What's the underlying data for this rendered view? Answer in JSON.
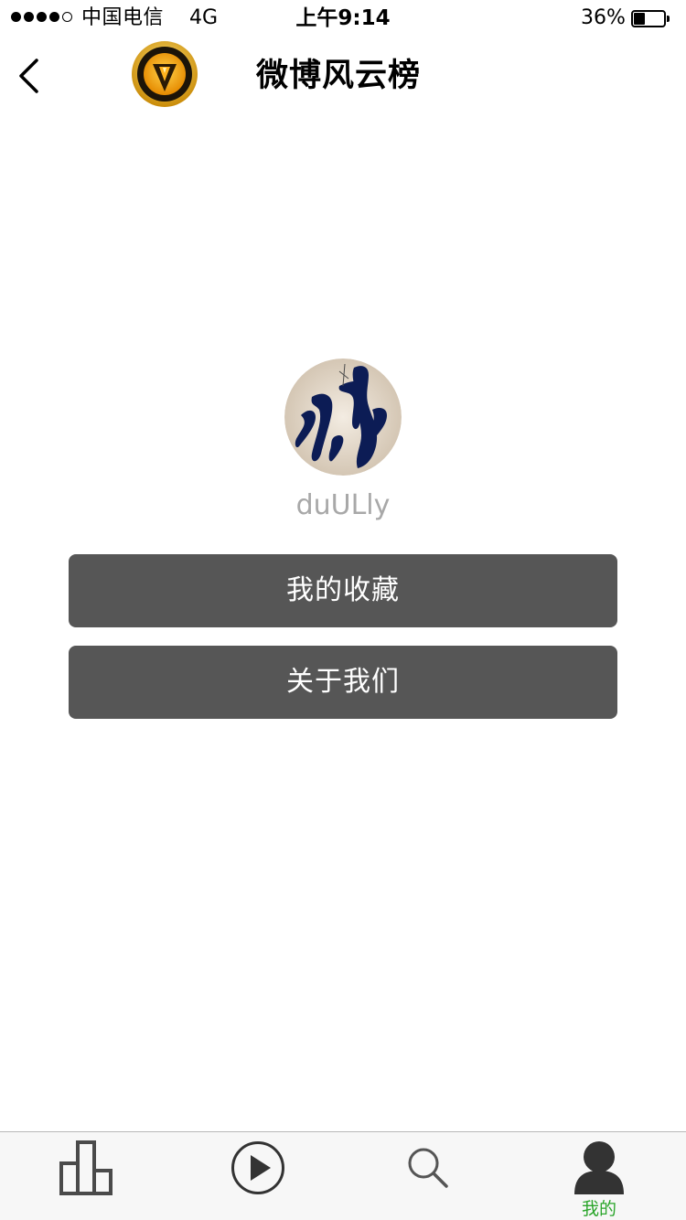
{
  "status_bar": {
    "signal_bars": 5,
    "signal_filled": 4,
    "carrier": "中国电信",
    "network": "4G",
    "time": "上午9:14",
    "battery_percent_text": "36%",
    "battery_level": 0.36
  },
  "nav": {
    "back_icon": "chevron-left-icon",
    "logo_icon": "gold-badge-logo",
    "title": "微博风云榜"
  },
  "profile": {
    "username": "duULly"
  },
  "menu": {
    "favorites_label": "我的收藏",
    "about_label": "关于我们"
  },
  "tab_bar": {
    "tabs": [
      {
        "icon": "bar-chart-icon",
        "label": "",
        "active": false
      },
      {
        "icon": "play-circle-icon",
        "label": "",
        "active": false
      },
      {
        "icon": "search-icon",
        "label": "",
        "active": false
      },
      {
        "icon": "person-icon",
        "label": "我的",
        "active": true
      }
    ],
    "active_color": "#2aa52a"
  },
  "colors": {
    "button_bg": "#565656",
    "button_text": "#ffffff",
    "username_text": "#a8a8a8",
    "tab_bar_bg": "#f7f7f7"
  }
}
